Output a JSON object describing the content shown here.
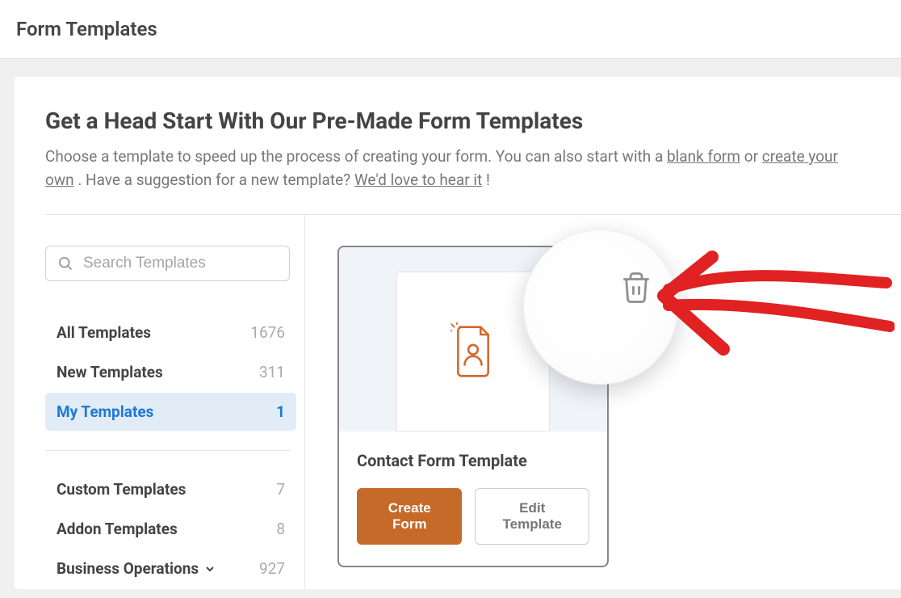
{
  "header": {
    "title": "Form Templates"
  },
  "intro": {
    "heading": "Get a Head Start With Our Pre-Made Form Templates",
    "text_before_blank": "Choose a template to speed up the process of creating your form. You can also start with a ",
    "blank_link": "blank form",
    "text_or": " or ",
    "create_link": "create your own",
    "text_period": ". Have a suggestion for a new template? ",
    "hear_link": "We'd love to hear it",
    "text_bang": "!"
  },
  "search": {
    "placeholder": "Search Templates"
  },
  "sidebar": {
    "items": [
      {
        "name": "All Templates",
        "count": "1676"
      },
      {
        "name": "New Templates",
        "count": "311"
      },
      {
        "name": "My Templates",
        "count": "1"
      }
    ],
    "items2": [
      {
        "name": "Custom Templates",
        "count": "7"
      },
      {
        "name": "Addon Templates",
        "count": "8"
      },
      {
        "name": "Business Operations",
        "count": "927"
      }
    ]
  },
  "template": {
    "title": "Contact Form Template",
    "create_label": "Create Form",
    "edit_label": "Edit Template"
  }
}
